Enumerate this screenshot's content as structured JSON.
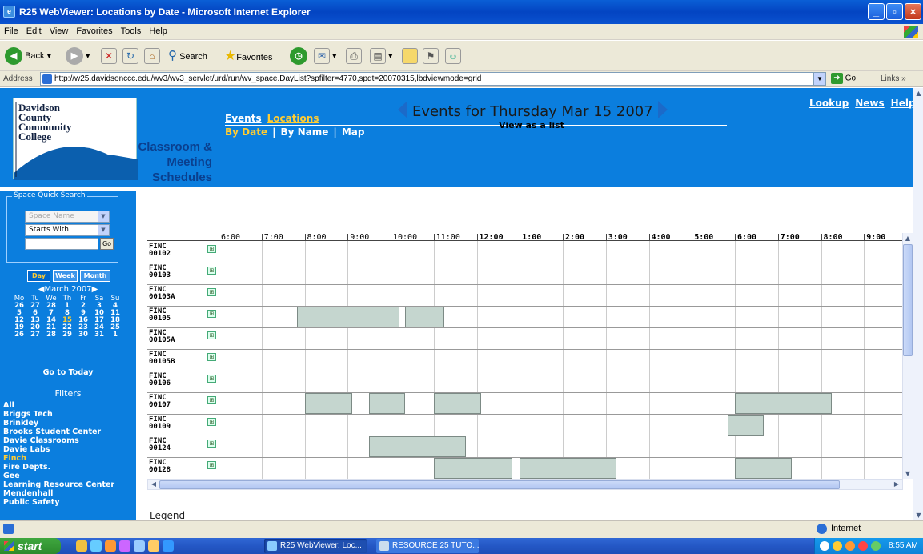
{
  "window": {
    "title": "R25 WebViewer: Locations by Date - Microsoft Internet Explorer"
  },
  "menu": [
    "File",
    "Edit",
    "View",
    "Favorites",
    "Tools",
    "Help"
  ],
  "toolbar": {
    "back": "Back",
    "search": "Search",
    "favorites": "Favorites"
  },
  "address": {
    "label": "Address",
    "url": "http://w25.davidsonccc.edu/wv3/wv3_servlet/urd/run/wv_space.DayList?spfilter=4770,spdt=20070315,lbdviewmode=grid",
    "go": "Go",
    "links": "Links"
  },
  "header": {
    "logo_lines": [
      "Davidson",
      "County",
      "Community",
      "College"
    ],
    "title_lines": [
      "Classroom &",
      "Meeting Schedules"
    ],
    "nav1": [
      "Events",
      "Locations"
    ],
    "nav2": [
      "By Date",
      "By Name",
      "Map"
    ],
    "toplinks": [
      "Lookup",
      "News",
      "Help"
    ]
  },
  "sidebar": {
    "quick_search_label": "Space Quick Search",
    "select1": "Space Name",
    "select2": "Starts With",
    "go": "Go",
    "views": [
      "Day",
      "Week",
      "Month"
    ],
    "calendar_month": "March 2007",
    "dow": [
      "Mo",
      "Tu",
      "We",
      "Th",
      "Fr",
      "Sa",
      "Su"
    ],
    "weeks": [
      [
        "26",
        "27",
        "28",
        "1",
        "2",
        "3",
        "4"
      ],
      [
        "5",
        "6",
        "7",
        "8",
        "9",
        "10",
        "11"
      ],
      [
        "12",
        "13",
        "14",
        "15",
        "16",
        "17",
        "18"
      ],
      [
        "19",
        "20",
        "21",
        "22",
        "23",
        "24",
        "25"
      ],
      [
        "26",
        "27",
        "28",
        "29",
        "30",
        "31",
        "1"
      ]
    ],
    "go_to_today": "Go to Today",
    "filters_label": "Filters",
    "filters": [
      "All",
      "Briggs Tech",
      "Brinkley",
      "Brooks Student Center",
      "Davie Classrooms",
      "Davie Labs",
      "Finch",
      "Fire Depts.",
      "Gee",
      "Learning Resource Center",
      "Mendenhall",
      "Public Safety"
    ],
    "active_filter": "Finch"
  },
  "main": {
    "events_header": "Events for Thursday Mar 15 2007",
    "view_as_list": "View as a list",
    "hours": [
      "6:00",
      "7:00",
      "8:00",
      "9:00",
      "10:00",
      "11:00",
      "12:00",
      "1:00",
      "2:00",
      "3:00",
      "4:00",
      "5:00",
      "6:00",
      "7:00",
      "8:00",
      "9:00"
    ],
    "rooms": [
      {
        "name": [
          "FINC",
          "00102"
        ],
        "events": []
      },
      {
        "name": [
          "FINC",
          "00103"
        ],
        "events": []
      },
      {
        "name": [
          "FINC",
          "00103A"
        ],
        "events": []
      },
      {
        "name": [
          "FINC",
          "00105"
        ],
        "events": [
          [
            7.83,
            10.2
          ],
          [
            10.33,
            11.25
          ]
        ]
      },
      {
        "name": [
          "FINC",
          "00105A"
        ],
        "events": []
      },
      {
        "name": [
          "FINC",
          "00105B"
        ],
        "events": []
      },
      {
        "name": [
          "FINC",
          "00106"
        ],
        "events": []
      },
      {
        "name": [
          "FINC",
          "00107"
        ],
        "events": [
          [
            8.0,
            9.1
          ],
          [
            9.5,
            10.33
          ],
          [
            11.0,
            12.1
          ],
          [
            18.0,
            20.25
          ]
        ]
      },
      {
        "name": [
          "FINC",
          "00109"
        ],
        "events": [
          [
            17.83,
            18.67
          ]
        ]
      },
      {
        "name": [
          "FINC",
          "00124"
        ],
        "events": [
          [
            9.5,
            11.75
          ]
        ]
      },
      {
        "name": [
          "FINC",
          "00128"
        ],
        "events": [
          [
            11.0,
            12.83
          ],
          [
            13.0,
            15.25
          ],
          [
            18.0,
            19.33
          ]
        ]
      }
    ],
    "legend": "Legend"
  },
  "status": {
    "zone": "Internet"
  },
  "taskbar": {
    "start": "start",
    "tasks": [
      "R25 WebViewer: Loc...",
      "RESOURCE 25 TUTO..."
    ],
    "clock": "8:55 AM"
  },
  "colors": {
    "header_blue": "#0b7ede",
    "accent_yellow": "#ffcc33",
    "event_fill": "#c5d6cf"
  }
}
